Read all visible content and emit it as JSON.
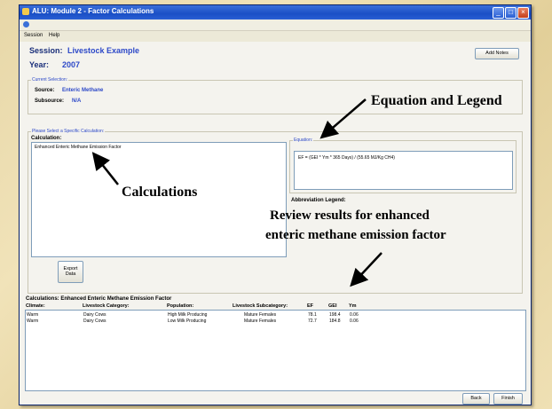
{
  "window": {
    "title": "ALU: Module 2 - Factor Calculations"
  },
  "menu": {
    "items": [
      "Session",
      "Help"
    ]
  },
  "header": {
    "session_label": "Session:",
    "session_value": "Livestock Example",
    "year_label": "Year:",
    "year_value": "2007",
    "add_notes": "Add Notes"
  },
  "current_selection": {
    "title": "Current Selection:",
    "source_label": "Source:",
    "source_value": "Enteric Methane",
    "subsource_label": "Subsource:",
    "subsource_value": "N/A"
  },
  "calc_select": {
    "title": "Please Select a Specific Calculation:",
    "calculation_label": "Calculation:",
    "items": [
      "Enhanced Enteric Methane Emission Factor"
    ],
    "export_label_1": "Export",
    "export_label_2": "Data"
  },
  "equation": {
    "label": "Equation:",
    "text": "EF = (GEI  * Ym * 365 Days) / (55.65 MJ/Kg CH4)",
    "legend_label": "Abbreviation Legend:"
  },
  "results": {
    "title": "Calculations: Enhanced Enteric Methane Emission Factor",
    "columns": [
      "Climate:",
      "Livestock Category:",
      "Population:",
      "Livestock Subcategory:",
      "EF",
      "GEI",
      "Ym"
    ],
    "rows": [
      [
        "Warm",
        "Dairy Cows",
        "High Milk Producing",
        "Mature Females",
        "78.1",
        "198.4",
        "0.06"
      ],
      [
        "Warm",
        "Dairy Cows",
        "Low Milk Producing",
        "Mature Females",
        "72.7",
        "184.8",
        "0.06"
      ]
    ]
  },
  "footer": {
    "back": "Back",
    "finish": "Finish"
  },
  "annotations": {
    "equation_legend": "Equation and Legend",
    "calculations": "Calculations",
    "review_line1": "Review results for enhanced",
    "review_line2": "enteric methane emission factor"
  }
}
